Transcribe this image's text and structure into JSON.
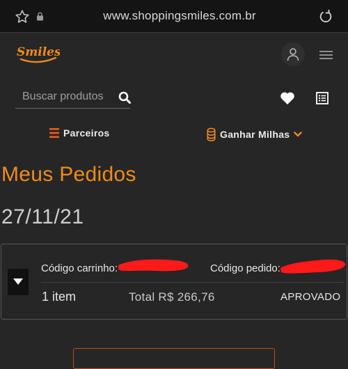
{
  "browser": {
    "url": "www.shoppingsmiles.com.br",
    "icons": [
      "star-icon",
      "lock-icon",
      "reload-icon"
    ]
  },
  "header": {
    "logo_text": "Smiles",
    "icons": [
      "user-icon",
      "menu-icon",
      "heart-icon",
      "list-icon"
    ],
    "search": {
      "placeholder": "Buscar produtos",
      "value": ""
    }
  },
  "nav": {
    "partners_label": "Parceiros",
    "miles_label": "Ganhar Milhas"
  },
  "page": {
    "title": "Meus Pedidos",
    "date": "27/11/21"
  },
  "order": {
    "cart_code_label": "Código carrinho:",
    "order_code_label": "Código pedido:",
    "items": "1 item",
    "total": "Total R$ 266,76",
    "status": "APROVADO"
  },
  "colors": {
    "accent": "#f08a1e",
    "background": "#262626",
    "browser_bar": "#141414",
    "redaction": "#ff1a1a"
  }
}
